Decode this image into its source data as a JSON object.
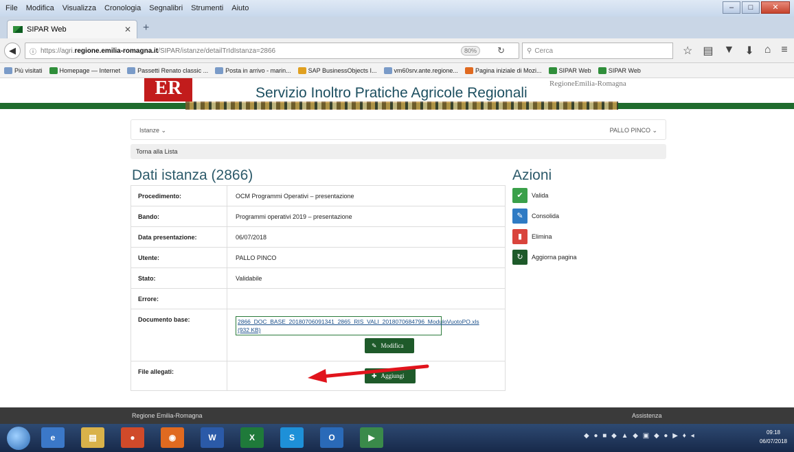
{
  "menu": [
    "File",
    "Modifica",
    "Visualizza",
    "Cronologia",
    "Segnalibri",
    "Strumenti",
    "Aiuto"
  ],
  "browser": {
    "tab_title": "SIPAR Web",
    "url_prefix": "https://agri.",
    "url_domain": "regione.emilia-romagna.it",
    "url_path": "/SIPAR/istanze/detailTrIdIstanza=2866",
    "zoom": "80%",
    "search_placeholder": "Cerca"
  },
  "bookmarks": [
    "Più visitati",
    "Homepage — Internet",
    "Passetti Renato classic ...",
    "Posta in arrivo - marin...",
    "SAP BusinessObjects I...",
    "vm60srv.ante.regione...",
    "Pagina iniziale di Mozi...",
    "SIPAR Web",
    "SIPAR Web"
  ],
  "header": {
    "logo": "ER",
    "title": "Servizio Inoltro Pratiche Agricole Regionali",
    "region": "RegioneEmilia-Romagna"
  },
  "nav": {
    "left": "Istanze ⌄",
    "right": "PALLO PINCO ⌄"
  },
  "breadcrumb": "Torna alla Lista",
  "page_title": "Dati istanza (2866)",
  "actions_title": "Azioni",
  "fields": {
    "procedimento": {
      "label": "Procedimento:",
      "value": "OCM Programmi Operativi – presentazione"
    },
    "bando": {
      "label": "Bando:",
      "value": "Programmi operativi 2019 – presentazione"
    },
    "data": {
      "label": "Data presentazione:",
      "value": "06/07/2018"
    },
    "utente": {
      "label": "Utente:",
      "value": "PALLO PINCO"
    },
    "stato": {
      "label": "Stato:",
      "value": "Validabile"
    },
    "errore": {
      "label": "Errore:",
      "value": ""
    },
    "documento": {
      "label": "Documento base:",
      "value": "2866_DOC_BASE_20180706091341_2865_RIS_VALI_2018070684796_ModuloVuotoPO.xls (932 KB)"
    },
    "allegati": {
      "label": "File allegati:"
    }
  },
  "buttons": {
    "modifica": "Modifica",
    "aggiungi": "Aggiungi"
  },
  "actions": [
    {
      "label": "Valida",
      "color": "#3aa04a",
      "icon": "check-icon"
    },
    {
      "label": "Consolida",
      "color": "#2f7bc4",
      "icon": "pencil-icon"
    },
    {
      "label": "Elimina",
      "color": "#d9443c",
      "icon": "trash-icon"
    },
    {
      "label": "Aggiorna pagina",
      "color": "#1e5a2a",
      "icon": "refresh-icon"
    }
  ],
  "footer": {
    "left": "Regione Emilia-Romagna",
    "right": "Assistenza"
  },
  "clock": {
    "time": "09:18",
    "date": "06/07/2018"
  }
}
